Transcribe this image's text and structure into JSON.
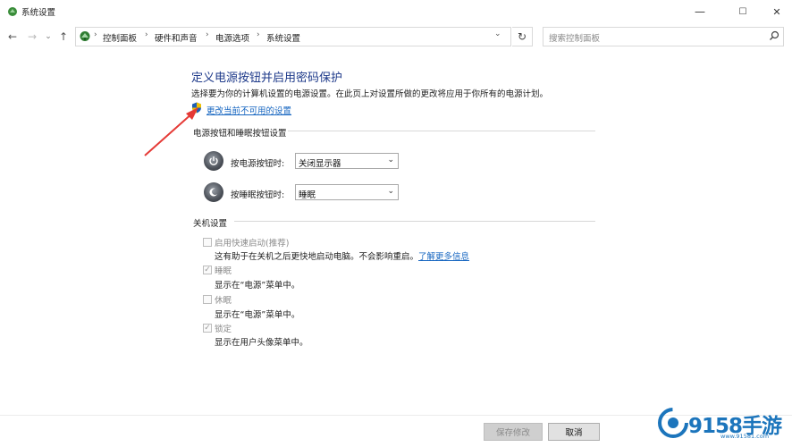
{
  "window": {
    "title": "系统设置",
    "controls": {
      "minimize": "—",
      "maximize": "☐",
      "close": "✕"
    }
  },
  "nav": {
    "back": "←",
    "forward": "→",
    "dropdown": "⌄",
    "up": "↑",
    "breadcrumbs": [
      "控制面板",
      "硬件和声音",
      "电源选项",
      "系统设置"
    ],
    "sep": "›",
    "refresh": "↻",
    "address_dropdown": "⌄",
    "search_placeholder": "搜索控制面板"
  },
  "main": {
    "heading": "定义电源按钮并启用密码保护",
    "subtitle": "选择要为你的计算机设置的电源设置。在此页上对设置所做的更改将应用于你所有的电源计划。",
    "change_link": "更改当前不可用的设置",
    "power_section": {
      "title": "电源按钮和睡眠按钮设置",
      "power_button": {
        "label": "按电源按钮时:",
        "value": "关闭显示器"
      },
      "sleep_button": {
        "label": "按睡眠按钮时:",
        "value": "睡眠"
      }
    },
    "shutdown_section": {
      "title": "关机设置",
      "options": [
        {
          "label": "启用快速启动(推荐)",
          "checked": false,
          "desc": "这有助于在关机之后更快地启动电脑。不会影响重启。",
          "link": "了解更多信息"
        },
        {
          "label": "睡眠",
          "checked": true,
          "desc": "显示在“电源”菜单中。"
        },
        {
          "label": "休眠",
          "checked": false,
          "desc": "显示在“电源”菜单中。"
        },
        {
          "label": "锁定",
          "checked": true,
          "desc": "显示在用户头像菜单中。"
        }
      ]
    }
  },
  "footer": {
    "save_label": "保存修改",
    "cancel_label": "取消"
  },
  "watermark": {
    "brand": "9158手游",
    "url": "www.91581.com"
  },
  "colors": {
    "heading": "#1e3a8a",
    "link": "#1565c0",
    "annotation_arrow": "#e53935",
    "watermark": "#1c75bc"
  }
}
